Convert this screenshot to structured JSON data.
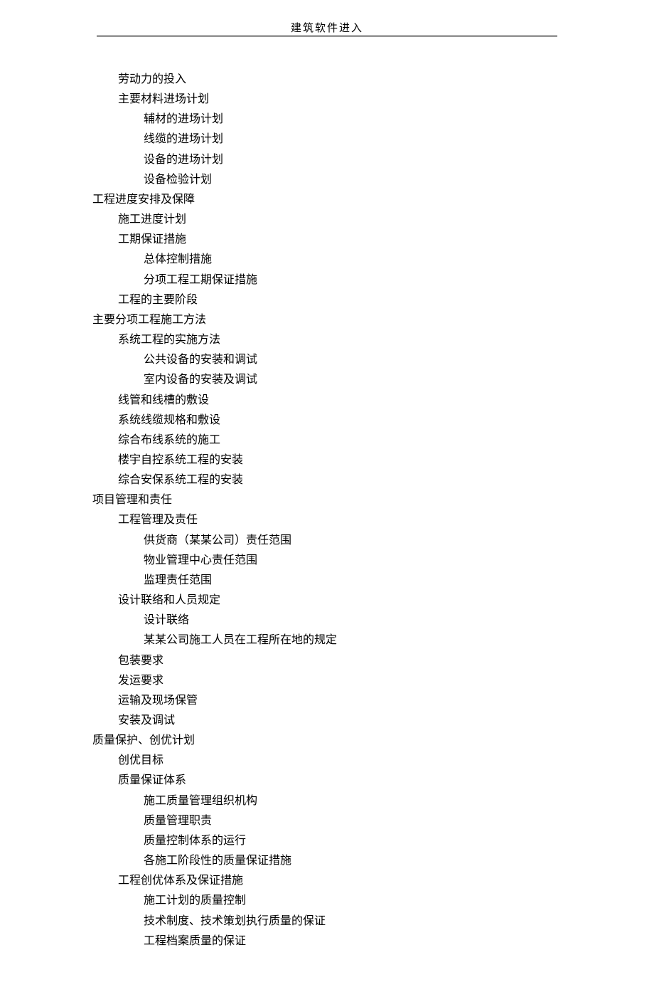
{
  "header": "建筑软件进入",
  "items": [
    {
      "level": 2,
      "text": "劳动力的投入"
    },
    {
      "level": 2,
      "text": "主要材料进场计划"
    },
    {
      "level": 3,
      "text": "辅材的进场计划"
    },
    {
      "level": 3,
      "text": "线缆的进场计划"
    },
    {
      "level": 3,
      "text": "设备的进场计划"
    },
    {
      "level": 3,
      "text": "设备检验计划"
    },
    {
      "level": 1,
      "text": "工程进度安排及保障"
    },
    {
      "level": 2,
      "text": "施工进度计划"
    },
    {
      "level": 2,
      "text": "工期保证措施"
    },
    {
      "level": 3,
      "text": "总体控制措施"
    },
    {
      "level": 3,
      "text": "分项工程工期保证措施"
    },
    {
      "level": 2,
      "text": "工程的主要阶段"
    },
    {
      "level": 1,
      "text": "主要分项工程施工方法"
    },
    {
      "level": 2,
      "text": "系统工程的实施方法"
    },
    {
      "level": 3,
      "text": "公共设备的安装和调试"
    },
    {
      "level": 3,
      "text": "室内设备的安装及调试"
    },
    {
      "level": 2,
      "text": "线管和线槽的敷设"
    },
    {
      "level": 2,
      "text": "系统线缆规格和敷设"
    },
    {
      "level": 2,
      "text": "综合布线系统的施工"
    },
    {
      "level": 2,
      "text": "楼宇自控系统工程的安装"
    },
    {
      "level": 2,
      "text": "综合安保系统工程的安装"
    },
    {
      "level": 1,
      "text": "项目管理和责任"
    },
    {
      "level": 2,
      "text": "工程管理及责任"
    },
    {
      "level": 3,
      "text": "供货商（某某公司）责任范围"
    },
    {
      "level": 3,
      "text": "物业管理中心责任范围"
    },
    {
      "level": 3,
      "text": "监理责任范围"
    },
    {
      "level": 2,
      "text": "设计联络和人员规定"
    },
    {
      "level": 3,
      "text": "设计联络"
    },
    {
      "level": 3,
      "text": "某某公司施工人员在工程所在地的规定"
    },
    {
      "level": 2,
      "text": "包装要求"
    },
    {
      "level": 2,
      "text": "发运要求"
    },
    {
      "level": 2,
      "text": "运输及现场保管"
    },
    {
      "level": 2,
      "text": "安装及调试"
    },
    {
      "level": 1,
      "text": "质量保护、创优计划"
    },
    {
      "level": 2,
      "text": "创优目标"
    },
    {
      "level": 2,
      "text": "质量保证体系"
    },
    {
      "level": 3,
      "text": "施工质量管理组织机构"
    },
    {
      "level": 3,
      "text": "质量管理职责"
    },
    {
      "level": 3,
      "text": "质量控制体系的运行"
    },
    {
      "level": 3,
      "text": "各施工阶段性的质量保证措施"
    },
    {
      "level": 2,
      "text": "工程创优体系及保证措施"
    },
    {
      "level": 3,
      "text": "施工计划的质量控制"
    },
    {
      "level": 3,
      "text": "技术制度、技术策划执行质量的保证"
    },
    {
      "level": 3,
      "text": "工程档案质量的保证"
    }
  ]
}
